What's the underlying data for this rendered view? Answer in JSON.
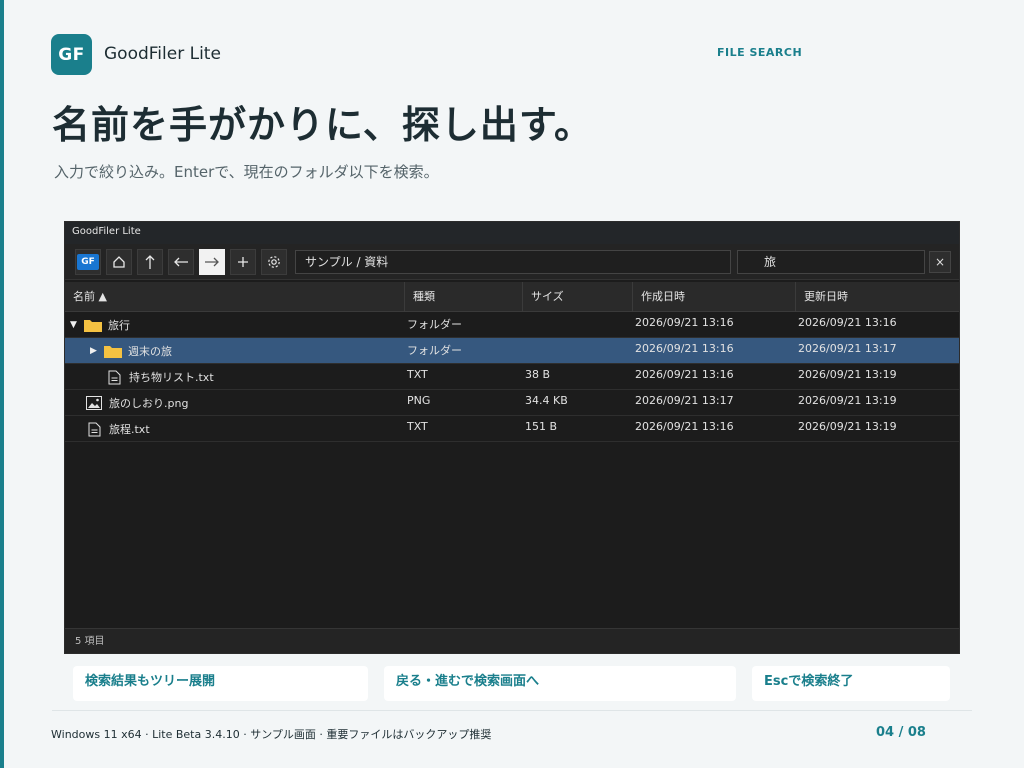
{
  "brand": {
    "logo_text": "GF",
    "name": "GoodFiler Lite",
    "section": "FILE SEARCH"
  },
  "slide": {
    "headline": "名前を手がかりに、探し出す。",
    "subline": "入力で絞り込み。Enterで、現在のフォルダ以下を検索。"
  },
  "window": {
    "title": "GoodFiler Lite",
    "toolbar": {
      "logo_text": "GF",
      "buttons": [
        "home-icon",
        "up-arrow-icon",
        "back-arrow-icon",
        "forward-arrow-icon",
        "plus-icon",
        "gear-icon"
      ],
      "path": "サンプル / 資料",
      "search_value": "旅",
      "clear_label": "×"
    },
    "columns": [
      "名前 ▲",
      "種類",
      "サイズ",
      "作成日時",
      "更新日時"
    ],
    "rows": [
      {
        "name": "旅行",
        "type": "フォルダー",
        "size": "",
        "created": "2026/09/21 13:16",
        "modified": "2026/09/21 13:16",
        "icon": "folder-icon",
        "expander": "▼",
        "selected": false
      },
      {
        "name": "週末の旅",
        "type": "フォルダー",
        "size": "",
        "created": "2026/09/21 13:16",
        "modified": "2026/09/21 13:17",
        "icon": "folder-icon",
        "expander": "▶",
        "selected": true
      },
      {
        "name": "持ち物リスト.txt",
        "type": "TXT",
        "size": "38 B",
        "created": "2026/09/21 13:16",
        "modified": "2026/09/21 13:19",
        "icon": "text-file-icon",
        "expander": "",
        "selected": false
      },
      {
        "name": "旅のしおり.png",
        "type": "PNG",
        "size": "34.4 KB",
        "created": "2026/09/21 13:17",
        "modified": "2026/09/21 13:19",
        "icon": "image-file-icon",
        "expander": "",
        "selected": false
      },
      {
        "name": "旅程.txt",
        "type": "TXT",
        "size": "151 B",
        "created": "2026/09/21 13:16",
        "modified": "2026/09/21 13:19",
        "icon": "text-file-icon",
        "expander": "",
        "selected": false
      }
    ],
    "status": "5 項目"
  },
  "features": [
    "検索結果もツリー展開",
    "戻る・進むで検索画面へ",
    "Escで検索終了"
  ],
  "footer": {
    "text": "Windows 11 x64 · Lite Beta 3.4.10 · サンプル画面 · 重要ファイルはバックアップ推奨",
    "page": "04 / 08"
  },
  "colors": {
    "accent": "#1a7f8c",
    "selected_row": "#36587f",
    "folder": "#f5c242"
  }
}
